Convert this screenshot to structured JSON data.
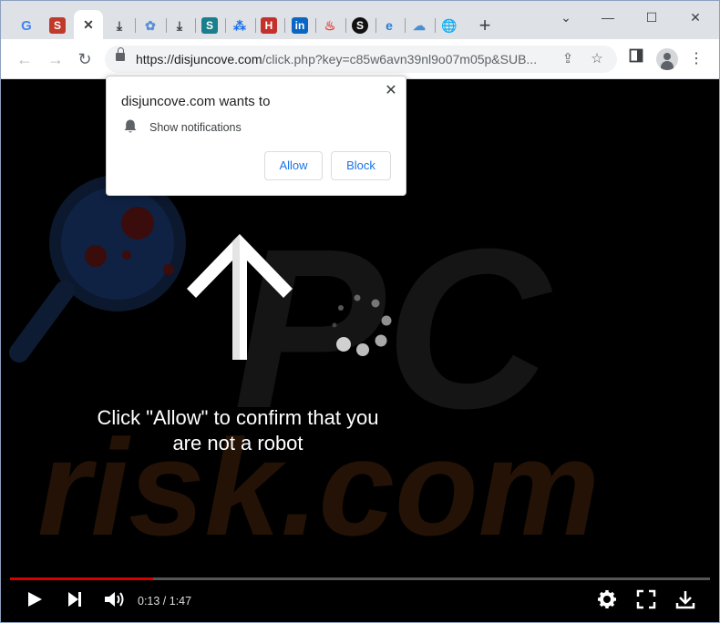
{
  "tabs": [
    {
      "icon": "google-icon",
      "letter": "G",
      "color": "#4285f4"
    },
    {
      "icon": "s-red-icon",
      "letter": "S",
      "color": "#c0392b"
    },
    {
      "icon": "close-icon",
      "letter": "✕",
      "color": "#3c4043"
    },
    {
      "icon": "download-icon",
      "letter": "⤓",
      "color": "#3c4043"
    },
    {
      "icon": "puzzle-blue-icon",
      "letter": "✿",
      "color": "#5b8fd8"
    },
    {
      "icon": "download-icon",
      "letter": "⤓",
      "color": "#3c4043"
    },
    {
      "icon": "s-teal-icon",
      "letter": "S",
      "color": "#1a7f8c"
    },
    {
      "icon": "grid-icon",
      "letter": "⁂",
      "color": "#1a73e8"
    },
    {
      "icon": "h-red-icon",
      "letter": "H",
      "color": "#c4302b"
    },
    {
      "icon": "linkedin-icon",
      "letter": "in",
      "color": "#0a66c2"
    },
    {
      "icon": "flame-icon",
      "letter": "♨",
      "color": "#e8453c"
    },
    {
      "icon": "s-black-icon",
      "letter": "S",
      "color": "#111111"
    },
    {
      "icon": "edge-icon",
      "letter": "e",
      "color": "#2b7bd6"
    },
    {
      "icon": "cloud-icon",
      "letter": "☁",
      "color": "#4a8fd0"
    },
    {
      "icon": "globe-icon",
      "letter": "🌐",
      "color": "#5f6368"
    }
  ],
  "address": {
    "host": "https://disjuncove.com",
    "path": "/click.php?key=c85w6avn39nl9o07m05p&SUB..."
  },
  "popup": {
    "title": "disjuncove.com wants to",
    "permission": "Show notifications",
    "allow_label": "Allow",
    "block_label": "Block",
    "close_glyph": "✕"
  },
  "message": {
    "line1": "Click \"Allow\" to confirm that you",
    "line2": "are not a robot"
  },
  "video": {
    "time": "0:13 / 1:47",
    "progress": 0.204
  },
  "colors": {
    "accent": "#1a73e8",
    "progress": "#d60000"
  }
}
